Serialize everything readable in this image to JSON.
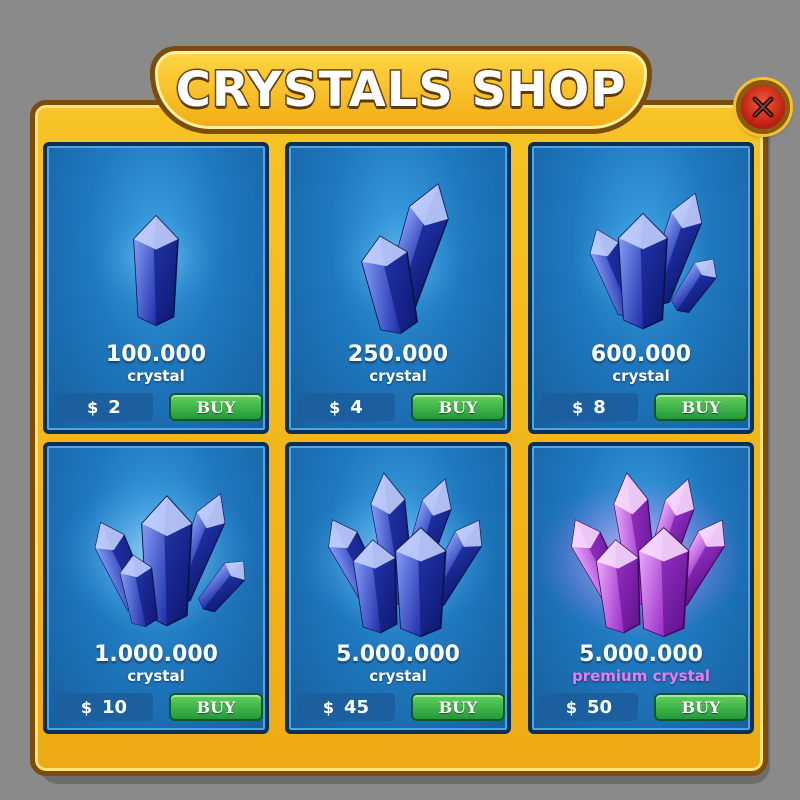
{
  "shop": {
    "title": "CRYSTALS SHOP"
  },
  "close_button": {
    "icon": "close-icon",
    "color": "#d8301b"
  },
  "colors": {
    "frame": "#f2b41a",
    "card": "#1f78bf",
    "buy_button": "#2aa23f",
    "premium_text": "#e77cf4"
  },
  "items": [
    {
      "amount": "100.000",
      "unit": "crystal",
      "currency": "$",
      "price": "2",
      "buy_label": "BUY",
      "icon": "single-crystal-icon"
    },
    {
      "amount": "250.000",
      "unit": "crystal",
      "currency": "$",
      "price": "4",
      "buy_label": "BUY",
      "icon": "crystal-pair-icon"
    },
    {
      "amount": "600.000",
      "unit": "crystal",
      "currency": "$",
      "price": "8",
      "buy_label": "BUY",
      "icon": "crystal-cluster-icon"
    },
    {
      "amount": "1.000.000",
      "unit": "crystal",
      "currency": "$",
      "price": "10",
      "buy_label": "BUY",
      "icon": "glowing-crystal-cluster-icon"
    },
    {
      "amount": "5.000.000",
      "unit": "crystal",
      "currency": "$",
      "price": "45",
      "buy_label": "BUY",
      "icon": "large-crystal-cluster-icon"
    },
    {
      "amount": "5.000.000",
      "unit": "premium crystal",
      "currency": "$",
      "price": "50",
      "buy_label": "BUY",
      "icon": "premium-crystal-cluster-icon"
    }
  ]
}
